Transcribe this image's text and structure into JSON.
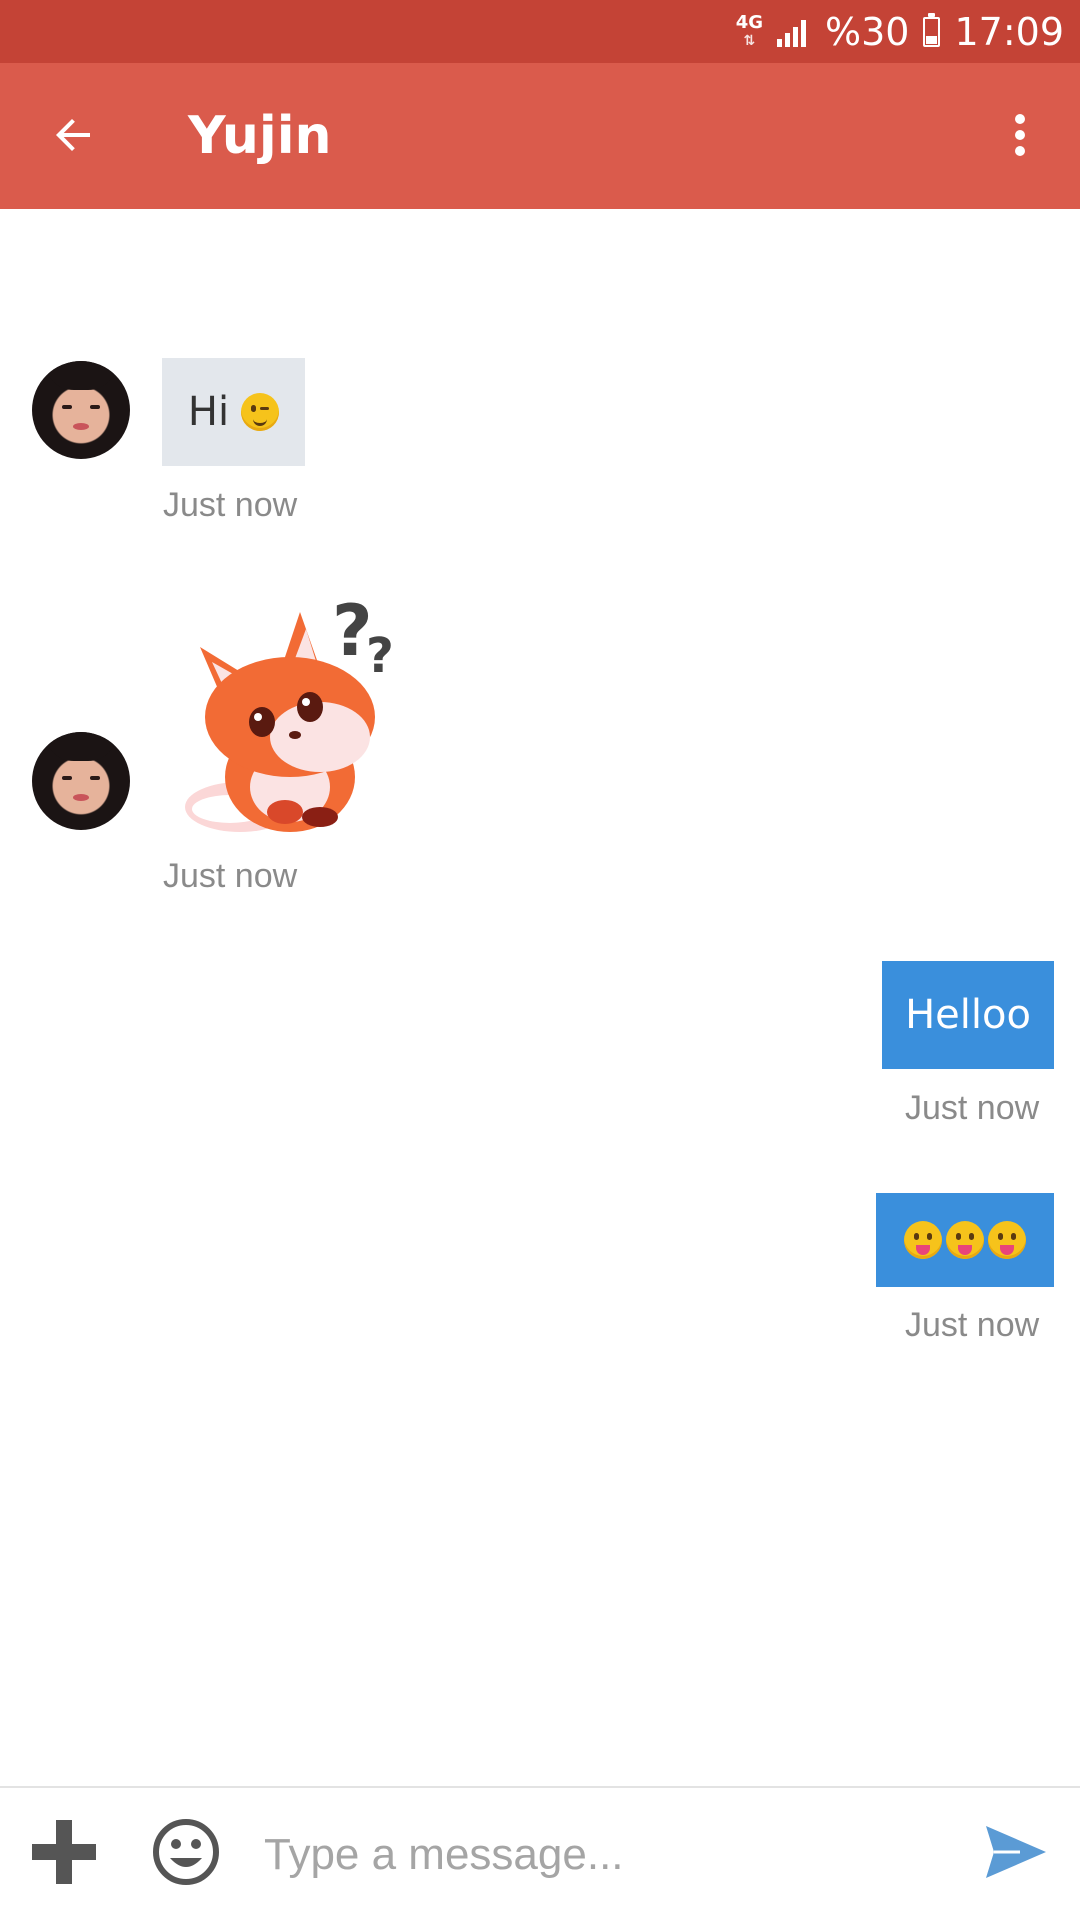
{
  "status_bar": {
    "network": "4G",
    "battery_text": "%30",
    "time": "17:09"
  },
  "header": {
    "title": "Yujin",
    "back_icon": "arrow-left-icon",
    "menu_icon": "more-vert-icon"
  },
  "messages": [
    {
      "direction": "incoming",
      "text": "Hi",
      "emoji": "winking-face",
      "time": "Just now"
    },
    {
      "direction": "incoming",
      "sticker": "confused-fox-sticker",
      "time": "Just now"
    },
    {
      "direction": "outgoing",
      "text": "Helloo",
      "time": "Just now"
    },
    {
      "direction": "outgoing",
      "emoji": "tongue-face x3",
      "time": "Just now"
    }
  ],
  "composer": {
    "placeholder": "Type a message...",
    "add_icon": "plus-icon",
    "emoji_icon": "smiley-icon",
    "send_icon": "send-icon"
  },
  "colors": {
    "status_bar": "#c44336",
    "app_bar": "#da5b4c",
    "incoming_bubble": "#e3e7ec",
    "outgoing_bubble": "#3a8fdc",
    "send_icon": "#5b9bd5"
  }
}
